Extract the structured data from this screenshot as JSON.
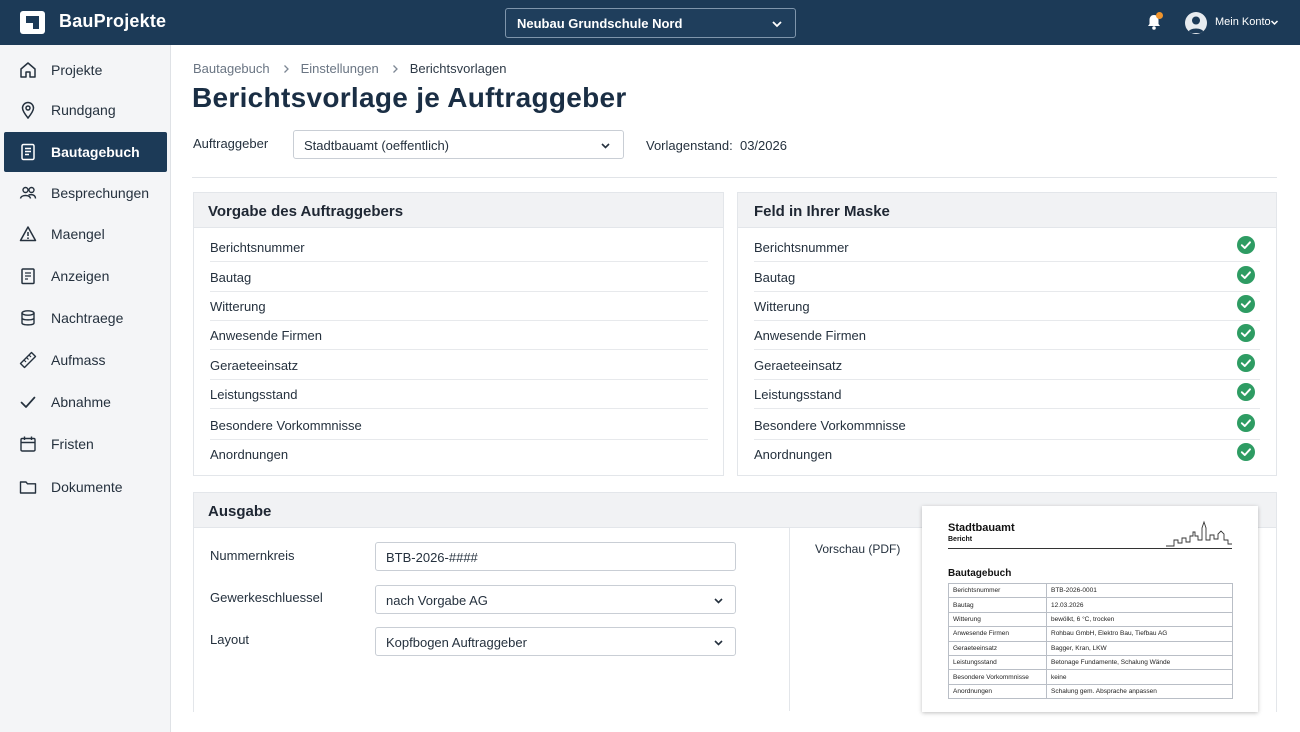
{
  "topbar": {
    "brand": "BauProjekte",
    "project": "Neubau Grundschule Nord",
    "account": "Mein Konto",
    "colors": {
      "bar": "#1c3a57",
      "notification_dot": "#f0942c"
    }
  },
  "sidebar": {
    "items": [
      {
        "label": "Projekte",
        "icon": "home-icon"
      },
      {
        "label": "Rundgang",
        "icon": "map-pin-icon"
      },
      {
        "label": "Bautagebuch",
        "icon": "diary-icon",
        "active": true
      },
      {
        "label": "Besprechungen",
        "icon": "people-icon"
      },
      {
        "label": "Maengel",
        "icon": "warning-icon"
      },
      {
        "label": "Anzeigen",
        "icon": "clipboard-icon"
      },
      {
        "label": "Nachtraege",
        "icon": "database-icon"
      },
      {
        "label": "Aufmass",
        "icon": "ruler-icon"
      },
      {
        "label": "Abnahme",
        "icon": "checkmark-icon"
      },
      {
        "label": "Fristen",
        "icon": "calendar-icon"
      },
      {
        "label": "Dokumente",
        "icon": "folder-icon"
      }
    ]
  },
  "breadcrumb": [
    "Bautagebuch",
    "Einstellungen",
    "Berichtsvorlagen"
  ],
  "page_title": "Berichtsvorlage je Auftraggeber",
  "client": {
    "label": "Auftraggeber",
    "selected": "Stadtbauamt (oeffentlich)",
    "version_label": "Vorlagenstand:",
    "version_value": "03/2026"
  },
  "mapping": {
    "left_title": "Vorgabe des Auftraggebers",
    "right_title": "Feld in Ihrer Maske",
    "fields": [
      "Berichtsnummer",
      "Bautag",
      "Witterung",
      "Anwesende Firmen",
      "Geraeteeinsatz",
      "Leistungsstand",
      "Besondere Vorkommnisse",
      "Anordnungen"
    ],
    "status_icon": "check-circle-icon",
    "status_color": "#2e9c63"
  },
  "output": {
    "title": "Ausgabe",
    "numbering_label": "Nummernkreis",
    "numbering_value": "BTB-2026-####",
    "trade_key_label": "Gewerkeschluessel",
    "trade_key_value": "nach Vorgabe AG",
    "layout_label": "Layout",
    "layout_value": "Kopfbogen Auftraggeber",
    "preview_label": "Vorschau (PDF)"
  },
  "pdf_preview": {
    "org": "Stadtbauamt",
    "subtitle": "Bericht",
    "doc_title": "Bautagebuch",
    "rows": [
      {
        "k": "Berichtsnummer",
        "v": "BTB-2026-0001"
      },
      {
        "k": "Bautag",
        "v": "12.03.2026"
      },
      {
        "k": "Witterung",
        "v": "bewölkt, 6 °C, trocken"
      },
      {
        "k": "Anwesende Firmen",
        "v": "Rohbau GmbH, Elektro Bau, Tiefbau AG"
      },
      {
        "k": "Geraeteeinsatz",
        "v": "Bagger, Kran, LKW"
      },
      {
        "k": "Leistungsstand",
        "v": "Betonage Fundamente, Schalung Wände"
      },
      {
        "k": "Besondere Vorkommnisse",
        "v": "keine"
      },
      {
        "k": "Anordnungen",
        "v": "Schalung gem. Absprache anpassen"
      }
    ]
  }
}
